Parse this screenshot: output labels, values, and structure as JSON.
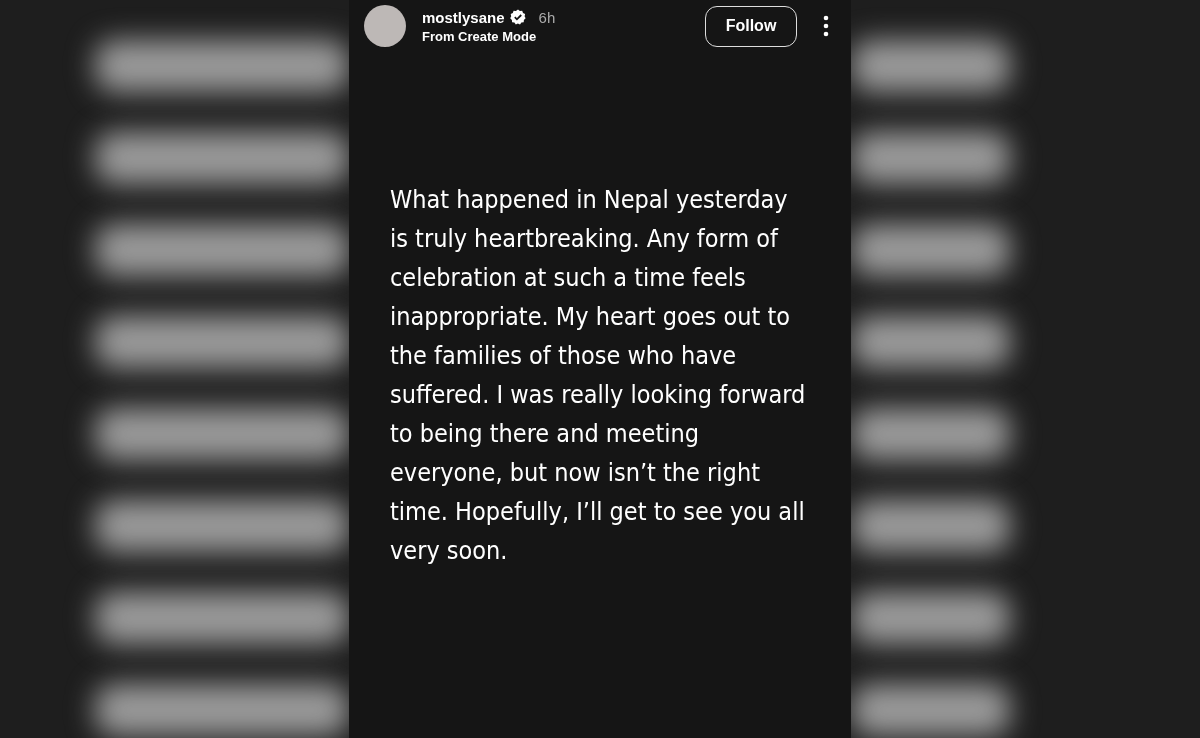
{
  "story": {
    "username": "mostlysane",
    "verified": true,
    "time": "6h",
    "subtitle": "From Create Mode",
    "follow_button": "Follow",
    "text": "What happened in Nepal yesterday is truly heartbreaking. Any form of celebration at such a time feels inappropriate. My heart goes out to the families of those who have suffered. I was really looking forward to being there and meeting everyone, but now isn’t the right time. Hopefully, I’ll get to see you all very soon."
  }
}
